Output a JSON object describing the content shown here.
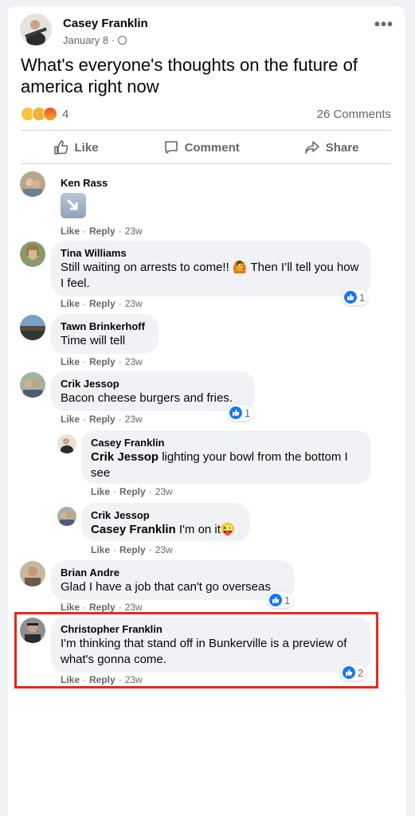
{
  "post": {
    "author": "Casey Franklin",
    "date": "January 8 ·",
    "text": "What's everyone's thoughts on the future of america right now",
    "reaction_count": "4",
    "comments_count": "26 Comments",
    "more_label": "•••",
    "actions": {
      "like": "Like",
      "comment": "Comment",
      "share": "Share"
    }
  },
  "comment_actions": {
    "like": "Like",
    "reply": "Reply",
    "sep": "·",
    "time": "23w"
  },
  "comments": [
    {
      "name": "Ken Rass",
      "text": "",
      "likes": ""
    },
    {
      "name": "Tina Williams",
      "text": "Still waiting on arrests to come!! 🙆 Then I’ll tell you how I feel.",
      "likes": "1"
    },
    {
      "name": "Tawn Brinkerhoff",
      "text": "Time will tell",
      "likes": ""
    },
    {
      "name": "Crik Jessop",
      "text": "Bacon cheese burgers and fries.",
      "likes": "1"
    },
    {
      "name": "Casey Franklin",
      "mention": "Crik Jessop",
      "text": " lighting your bowl from the bottom I see",
      "likes": ""
    },
    {
      "name": "Crik Jessop",
      "mention": "Casey Franklin",
      "text": " I'm on it😜",
      "likes": ""
    },
    {
      "name": "Brian Andre",
      "text": "Glad I have a job that can't go overseas",
      "likes": "1"
    },
    {
      "name": "Christopher Franklin",
      "text": "I'm thinking that stand off in Bunkerville is a preview of what's gonna come.",
      "likes": "2"
    }
  ],
  "colors": {
    "accent": "#1877f2",
    "highlight": "#e8271c",
    "bubble": "#f0f2f5",
    "muted": "#65676b"
  }
}
